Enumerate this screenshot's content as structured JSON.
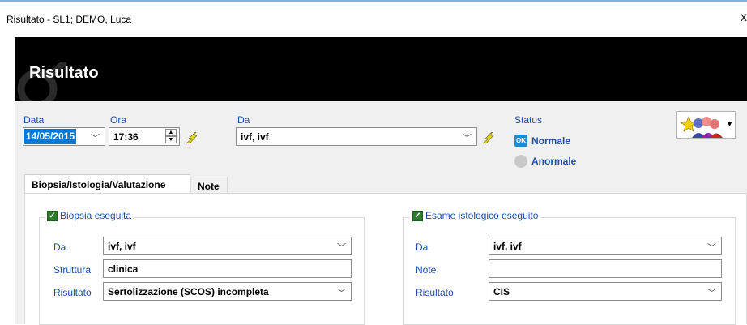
{
  "window": {
    "title": "Risultato - SL1; DEMO, Luca",
    "close": "x"
  },
  "header": {
    "title": "Risultato"
  },
  "fields": {
    "data": {
      "label": "Data",
      "value": "14/05/2015"
    },
    "ora": {
      "label": "Ora",
      "value": "17:36"
    },
    "da": {
      "label": "Da",
      "value": "ivf, ivf"
    }
  },
  "status": {
    "label": "Status",
    "ok_badge": "OK",
    "normal": "Normale",
    "abnormal": "Anormale",
    "selected": "Normale"
  },
  "tabs": [
    {
      "label": "Biopsia/Istologia/Valutazione",
      "active": true
    },
    {
      "label": "Note",
      "active": false
    }
  ],
  "biopsia": {
    "legend": "Biopsia eseguita",
    "checked": true,
    "da_label": "Da",
    "da_value": "ivf, ivf",
    "struttura_label": "Struttura",
    "struttura_value": "clinica",
    "risultato_label": "Risultato",
    "risultato_value": "Sertolizzazione (SCOS) incompleta"
  },
  "istologico": {
    "legend": "Esame istologico eseguito",
    "checked": true,
    "da_label": "Da",
    "da_value": "ivf, ivf",
    "note_label": "Note",
    "note_value": "",
    "risultato_label": "Risultato",
    "risultato_value": "CIS"
  },
  "icons": {
    "dropdown": "chevron-down-icon",
    "bolt": "lightning-icon",
    "people": "people-group-icon"
  },
  "colors": {
    "label_blue": "#1d4ea8",
    "ok_blue": "#1f8ad6",
    "checkbox_green": "#2d7a2d",
    "banner": "#000000"
  }
}
